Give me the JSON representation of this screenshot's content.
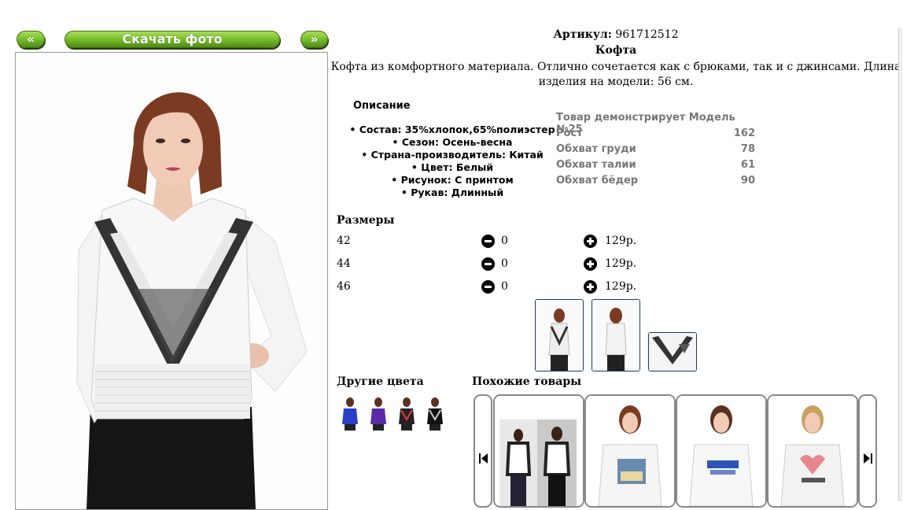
{
  "nav": {
    "prev_label": "«",
    "download_label": "Скачать фото",
    "next_label": "»"
  },
  "product": {
    "article_label": "Артикул:",
    "article_value": "961712512",
    "title": "Кофта",
    "description": "Кофта из комфортного материала. Отлично сочетается как с брюками, так и с джинсами. Длина изделия на модели: 56 см."
  },
  "specs": {
    "heading": "Описание",
    "items": [
      "Состав: 35%хлопок,65%полиэстер",
      "Сезон: Осень-весна",
      "Страна-производитель: Китай",
      "Цвет: Белый",
      "Рисунок: С принтом",
      "Рукав: Длинный"
    ]
  },
  "model": {
    "heading": "Товар демонстрирует Модель №25",
    "rows": [
      {
        "label": "Рост",
        "value": "162"
      },
      {
        "label": "Обхват груди",
        "value": "78"
      },
      {
        "label": "Обхват талии",
        "value": "61"
      },
      {
        "label": "Обхват бёдер",
        "value": "90"
      }
    ]
  },
  "sizes": {
    "heading": "Размеры",
    "rows": [
      {
        "size": "42",
        "qty": "0",
        "price": "129р."
      },
      {
        "size": "44",
        "qty": "0",
        "price": "129р."
      },
      {
        "size": "46",
        "qty": "0",
        "price": "129р."
      }
    ]
  },
  "other_colors": {
    "heading": "Другие цвета"
  },
  "similar": {
    "heading": "Похожие товары"
  },
  "colors": {
    "accent_green": "#7cc12d",
    "thumb_border": "#1e3a64",
    "model_text": "#777777"
  }
}
